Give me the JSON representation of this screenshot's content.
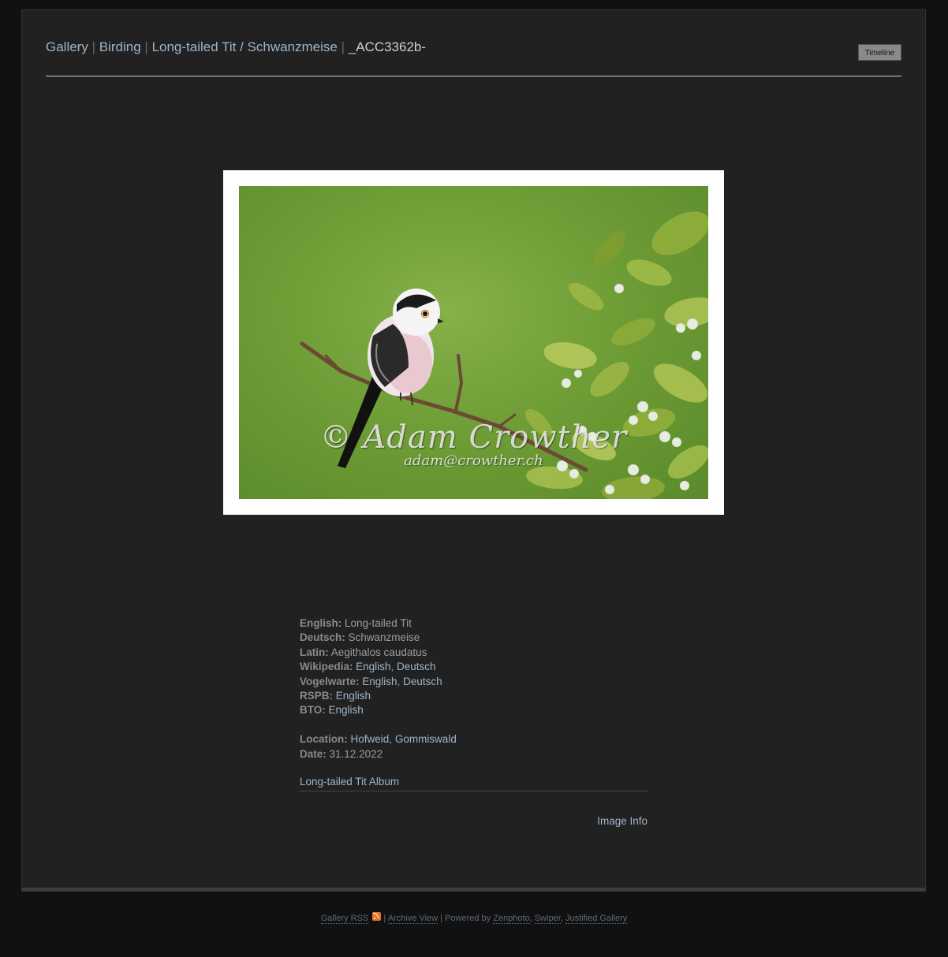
{
  "breadcrumb": {
    "items": [
      {
        "label": "Gallery"
      },
      {
        "label": "Birding"
      },
      {
        "label": "Long-tailed Tit / Schwanzmeise"
      }
    ],
    "separator": "|",
    "current": "_ACC3362b-"
  },
  "toolbar": {
    "timeline_label": "Timeline"
  },
  "photo": {
    "watermark_main": "© Adam Crowther",
    "watermark_sub": "adam@crowther.ch"
  },
  "info": {
    "english": {
      "label": "English:",
      "value": "Long-tailed Tit"
    },
    "deutsch": {
      "label": "Deutsch:",
      "value": "Schwanzmeise"
    },
    "latin": {
      "label": "Latin:",
      "value": "Aegithalos caudatus"
    },
    "wikipedia": {
      "label": "Wikipedia:",
      "links": [
        "English",
        "Deutsch"
      ]
    },
    "vogelwarte": {
      "label": "Vogelwarte:",
      "links": [
        "English",
        "Deutsch"
      ]
    },
    "rspb": {
      "label": "RSPB:",
      "links": [
        "English"
      ]
    },
    "bto": {
      "label": "BTO:",
      "links": [
        "English"
      ]
    },
    "location": {
      "label": "Location:",
      "links": [
        "Hofweid",
        "Gommiswald"
      ]
    },
    "date": {
      "label": "Date:",
      "value": "31.12.2022"
    },
    "link_separator": ", "
  },
  "album_link": "Long-tailed Tit Album",
  "image_info_label": "Image Info",
  "footer": {
    "gallery_rss": "Gallery RSS",
    "sep": "|",
    "archive_view": "Archive View",
    "powered_by": "Powered by",
    "zenphoto": "Zenphoto",
    "swiper": "Swiper",
    "justified_gallery": "Justified Gallery",
    "comma": ","
  },
  "colors": {
    "page_bg": "#111111",
    "panel_bg": "#212121",
    "link": "#9fb4c8",
    "text": "#9a9a9a",
    "rss": "#e8742a"
  }
}
